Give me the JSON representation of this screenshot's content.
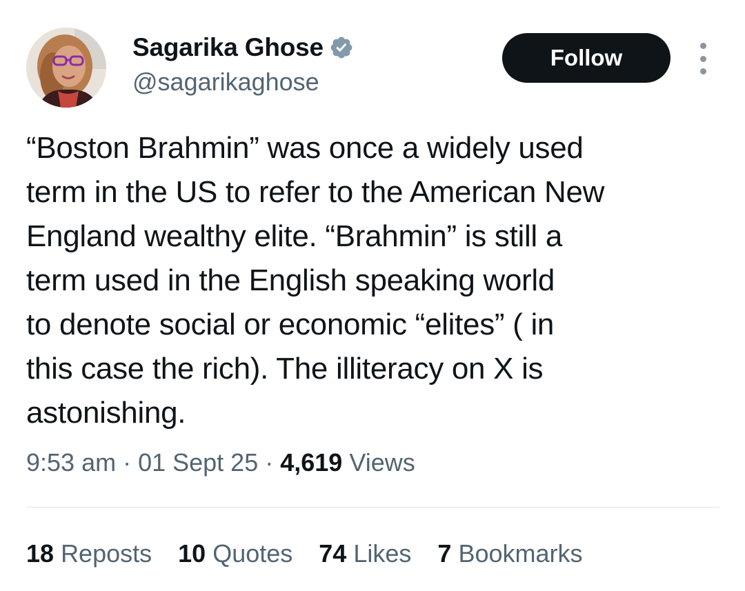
{
  "author": {
    "display_name": "Sagarika Ghose",
    "handle": "@sagarikaghose",
    "verified_icon": "verified-badge-icon"
  },
  "actions": {
    "follow_label": "Follow",
    "more_icon": "more-options-icon"
  },
  "tweet": {
    "text": "“Boston Brahmin” was once a widely used\nterm in the US to refer to the American New\nEngland wealthy elite. “Brahmin” is still a\nterm used in the English speaking world\nto denote social or economic  “elites” ( in\nthis case the rich). The illiteracy on X is\nastonishing."
  },
  "meta": {
    "time": "9:53 am",
    "separator": " · ",
    "date": "01 Sept 25",
    "views_count": "4,619",
    "views_label": "Views"
  },
  "stats": {
    "reposts": {
      "count": "18",
      "label": "Reposts"
    },
    "quotes": {
      "count": "10",
      "label": "Quotes"
    },
    "likes": {
      "count": "74",
      "label": "Likes"
    },
    "bookmarks": {
      "count": "7",
      "label": "Bookmarks"
    }
  },
  "colors": {
    "text_primary": "#0f1419",
    "text_secondary": "#536471",
    "button_bg": "#0f1419",
    "button_text": "#ffffff",
    "verified_badge": "#829aab",
    "divider": "#e1e6ea"
  }
}
